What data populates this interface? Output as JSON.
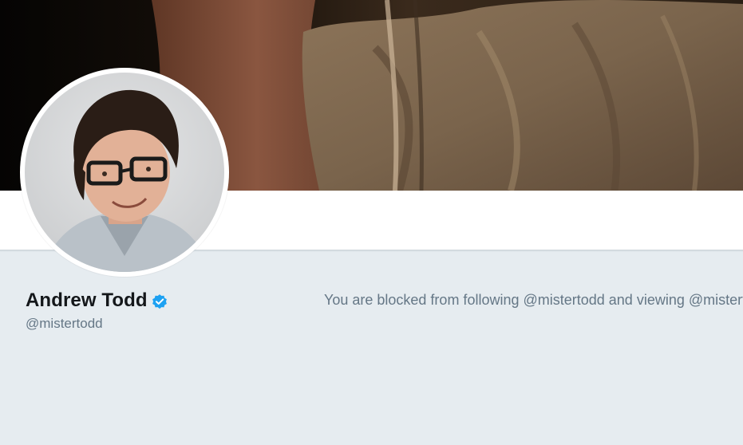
{
  "profile": {
    "name": "Andrew Todd",
    "handle": "@mistertodd",
    "verified": true,
    "verified_icon": "verified-badge-icon"
  },
  "blocked_notice": {
    "text": "You are blocked from following @mistertodd and viewing @mistertodd"
  },
  "colors": {
    "background": "#e6ecf0",
    "name_text": "#14171a",
    "secondary_text": "#657786",
    "verified_blue": "#1da1f2"
  }
}
